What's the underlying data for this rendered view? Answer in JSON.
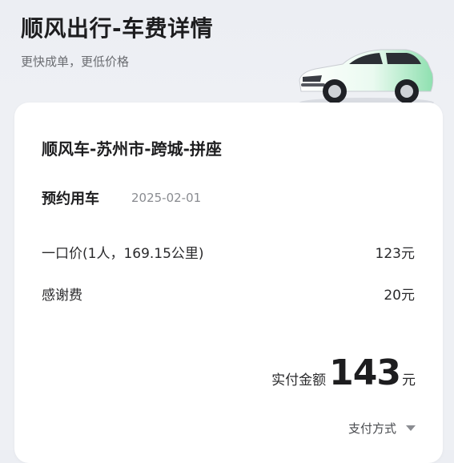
{
  "header": {
    "title": "顺风出行-车费详情",
    "subtitle": "更快成单，更低价格"
  },
  "trip": {
    "title": "顺风车-苏州市-跨城-拼座",
    "ride_type": "预约用车",
    "date": "2025-02-01"
  },
  "fees": [
    {
      "label": "一口价(1人，169.15公里)",
      "amount": "123元"
    },
    {
      "label": "感谢费",
      "amount": "20元"
    }
  ],
  "total": {
    "label": "实付金额",
    "value": "143",
    "unit": "元"
  },
  "payment": {
    "label": "支付方式"
  },
  "icons": {
    "car": "car-icon",
    "dropdown": "chevron-down-icon"
  },
  "colors": {
    "background": "#eef0f4",
    "card": "#ffffff",
    "accent_green": "#8fe0b0"
  }
}
